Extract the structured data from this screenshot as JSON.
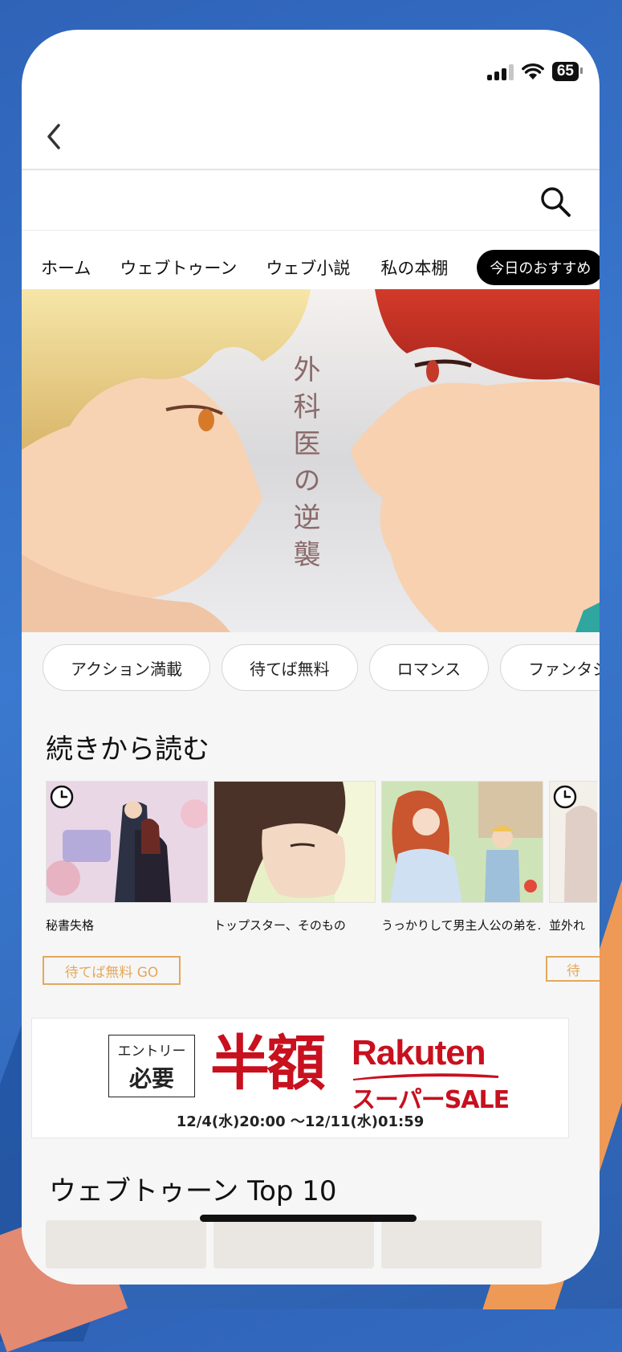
{
  "status": {
    "battery": "65"
  },
  "nav": {
    "items": [
      "ホーム",
      "ウェブトゥーン",
      "ウェブ小説",
      "私の本棚"
    ],
    "active": "今日のおすすめ"
  },
  "banner": {
    "title": "外科医の逆襲"
  },
  "chips": [
    "アクション満載",
    "待てば無料",
    "ロマンス",
    "ファンタジー"
  ],
  "continue": {
    "title": "続きから読む",
    "items": [
      "秘書失格",
      "トップスター、そのもの",
      "うっかりして男主人公の弟を...",
      "並外れ"
    ],
    "wait_button": "待てば無料 GO",
    "wait_button_partial": "待"
  },
  "ad": {
    "entry_line1": "エントリー",
    "entry_line2": "必要",
    "headline": "半額",
    "brand": "Rakuten",
    "sale": "スーパーSALE",
    "period": "12/4(水)20:00 〜12/11(水)01:59"
  },
  "top10": {
    "title": "ウェブトゥーン Top 10"
  },
  "colors": {
    "accent": "#e4a85a",
    "sale_red": "#c8101e",
    "active_pill": "#000000"
  }
}
